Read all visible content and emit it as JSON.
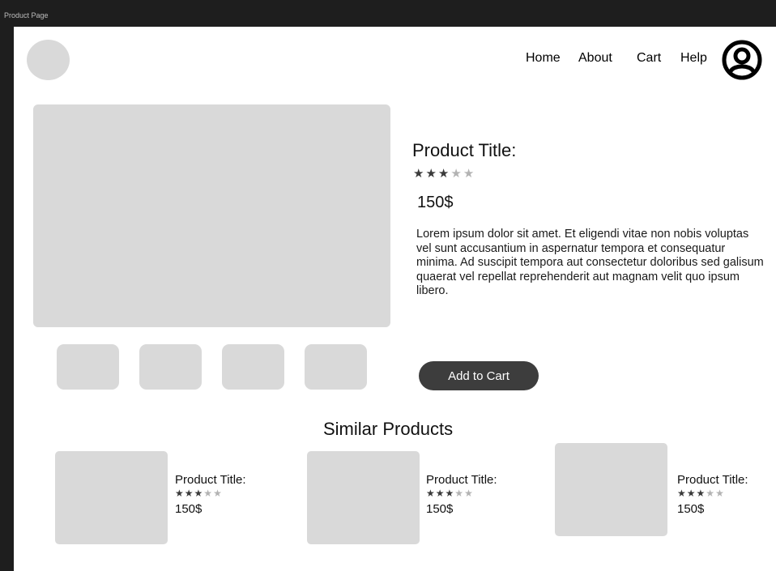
{
  "window": {
    "frame_label": "Product Page"
  },
  "header": {
    "nav": [
      "Home",
      "About",
      "Cart",
      "Help"
    ],
    "logo_icon": "logo-placeholder",
    "account_icon": "user-circle-icon"
  },
  "product": {
    "title": "Product Title:",
    "rating": 3,
    "rating_max": 5,
    "price": "150$",
    "description": "Lorem ipsum dolor sit amet. Et eligendi vitae non nobis voluptas vel sunt accusantium in aspernatur tempora et consequatur minima. Ad suscipit tempora aut consectetur doloribus sed galisum quaerat vel repellat reprehenderit aut magnam velit quo ipsum libero.",
    "add_to_cart_label": "Add to Cart"
  },
  "similar": {
    "heading": "Similar Products",
    "items": [
      {
        "title": "Product Title:",
        "rating": 3,
        "rating_max": 5,
        "price": "150$"
      },
      {
        "title": "Product Title:",
        "rating": 3,
        "rating_max": 5,
        "price": "150$"
      },
      {
        "title": "Product Title:",
        "rating": 3,
        "rating_max": 5,
        "price": "150$"
      }
    ]
  },
  "colors": {
    "placeholder": "#d9d9d9",
    "button": "#3d3d3d",
    "star_filled": "#3a3a3a",
    "star_empty": "#b3b3b3",
    "frame_background": "#1e1e1e"
  }
}
